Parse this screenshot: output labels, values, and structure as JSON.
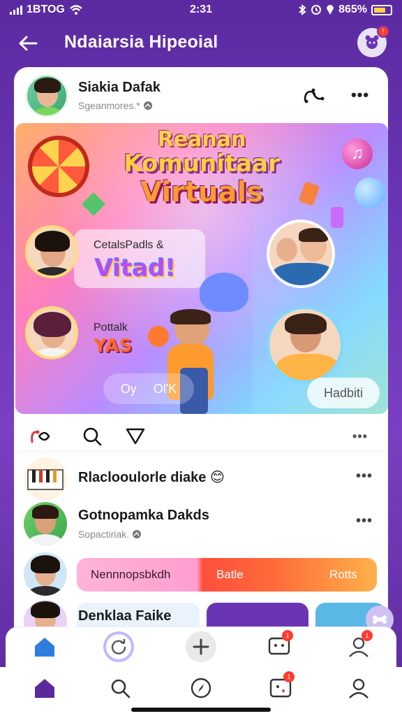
{
  "status_bar": {
    "left_text": "1BTOG",
    "time": "2:31",
    "battery_percent": "865%"
  },
  "header": {
    "title": "Ndaiarsia Hipeoial"
  },
  "post": {
    "author_name": "Siakia Dafak",
    "author_sub": "Sgeanmores.*"
  },
  "banner": {
    "title_line1": "Reanan",
    "title_line2": "Komunitaar",
    "title_line3": "Virtuals",
    "panel1_label": "CetalsPadls &",
    "panel1_big": "Vitad!",
    "panel2_label": "Pottalk",
    "panel2_big": "YAS",
    "pill_left_1": "Oy",
    "pill_left_2": "Ol'K",
    "pill_right": "Hadbiti"
  },
  "list": [
    {
      "title": "Rlaclooulorle diake",
      "emoji": "😊"
    },
    {
      "title": "Gotnopamka Dakds",
      "sub": "Sopactiriak."
    },
    {
      "bar_left": "Nennnopsbkdh",
      "bar_mid": "Batle",
      "bar_right": "Rotts"
    },
    {
      "title": "Denklaa Faike"
    }
  ],
  "nav": {
    "top_badges": {
      "messages": "1",
      "profile": "1"
    },
    "bottom_badges": {
      "activity": "1"
    }
  }
}
